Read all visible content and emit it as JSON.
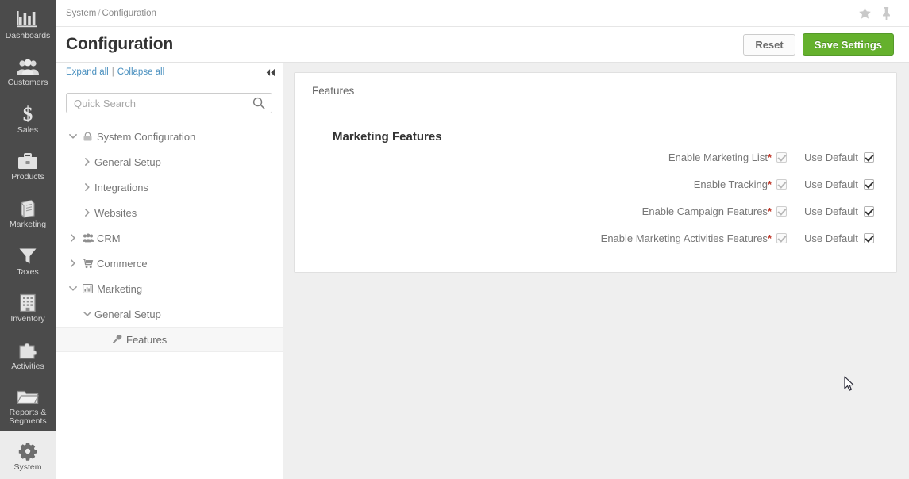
{
  "rail": {
    "items": [
      {
        "label": "Dashboards",
        "icon": "bar-chart-icon",
        "active": false
      },
      {
        "label": "Customers",
        "icon": "users-icon",
        "active": false
      },
      {
        "label": "Sales",
        "icon": "dollar-icon",
        "active": false
      },
      {
        "label": "Products",
        "icon": "briefcase-icon",
        "active": false
      },
      {
        "label": "Marketing",
        "icon": "book-icon",
        "active": false
      },
      {
        "label": "Taxes",
        "icon": "funnel-icon",
        "active": false
      },
      {
        "label": "Inventory",
        "icon": "building-icon",
        "active": false
      },
      {
        "label": "Activities",
        "icon": "puzzle-icon",
        "active": false
      },
      {
        "label": "Reports & Segments",
        "icon": "folder-icon",
        "active": false
      },
      {
        "label": "System",
        "icon": "gear-icon",
        "active": true
      }
    ]
  },
  "breadcrumb": {
    "root": "System",
    "separator": "/",
    "current": "Configuration"
  },
  "header": {
    "title": "Configuration",
    "reset_label": "Reset",
    "save_label": "Save Settings"
  },
  "tree_panel": {
    "expand_all": "Expand all",
    "collapse_all": "Collapse all",
    "separator": "|",
    "search": {
      "placeholder": "Quick Search",
      "value": ""
    },
    "items": [
      {
        "label": "System Configuration",
        "level": 0,
        "state": "expanded",
        "icon": "lock-icon",
        "active": false
      },
      {
        "label": "General Setup",
        "level": 1,
        "state": "collapsed",
        "icon": "",
        "active": false
      },
      {
        "label": "Integrations",
        "level": 1,
        "state": "collapsed",
        "icon": "",
        "active": false
      },
      {
        "label": "Websites",
        "level": 1,
        "state": "collapsed",
        "icon": "",
        "active": false
      },
      {
        "label": "CRM",
        "level": 0,
        "state": "collapsed",
        "icon": "users-icon",
        "active": false
      },
      {
        "label": "Commerce",
        "level": 0,
        "state": "collapsed",
        "icon": "cart-icon",
        "active": false
      },
      {
        "label": "Marketing",
        "level": 0,
        "state": "expanded",
        "icon": "bar-chart-icon",
        "active": false
      },
      {
        "label": "General Setup",
        "level": 1,
        "state": "expanded",
        "icon": "",
        "active": false
      },
      {
        "label": "Features",
        "level": 2,
        "state": "leaf",
        "icon": "wrench-icon",
        "active": true
      }
    ]
  },
  "content": {
    "card_title": "Features",
    "section_title": "Marketing Features",
    "use_default_label": "Use Default",
    "required_marker": "*",
    "fields": [
      {
        "label": "Enable Marketing List",
        "required": true,
        "checked": true,
        "disabled": true,
        "use_default_checked": true
      },
      {
        "label": "Enable Tracking",
        "required": true,
        "checked": true,
        "disabled": true,
        "use_default_checked": true
      },
      {
        "label": "Enable Campaign Features",
        "required": true,
        "checked": true,
        "disabled": true,
        "use_default_checked": true
      },
      {
        "label": "Enable Marketing Activities Features",
        "required": true,
        "checked": true,
        "disabled": true,
        "use_default_checked": true
      }
    ]
  },
  "colors": {
    "rail_bg": "#4b4b4b",
    "save_green": "#65b12d",
    "link_blue": "#4a90bf",
    "required_red": "#c0392b",
    "canvas_bg": "#efefef"
  }
}
